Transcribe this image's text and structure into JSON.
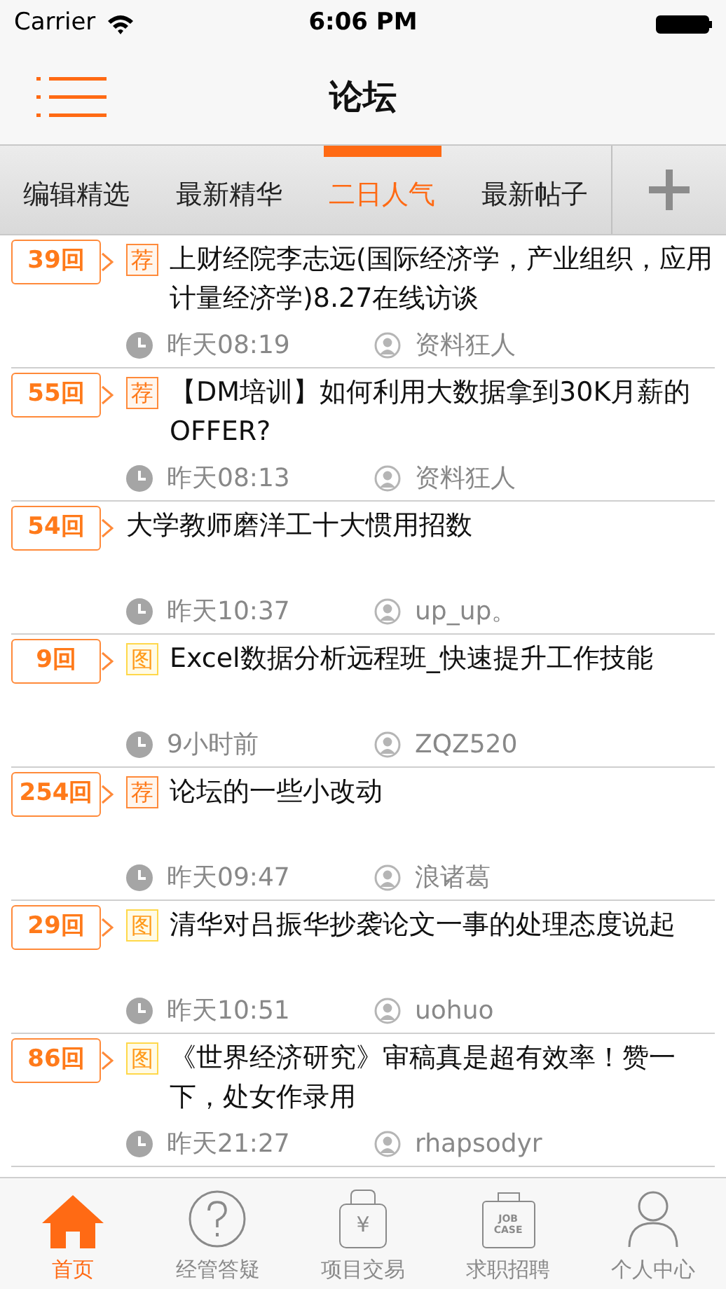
{
  "status_bar": {
    "carrier": "Carrier",
    "time": "6:06 PM"
  },
  "nav": {
    "title": "论坛"
  },
  "tabs": [
    {
      "label": "编辑精选",
      "selected": false
    },
    {
      "label": "最新精华",
      "selected": false
    },
    {
      "label": "二日人气",
      "selected": true
    },
    {
      "label": "最新帖子",
      "selected": false
    }
  ],
  "posts": [
    {
      "replies": "39回",
      "tag": {
        "text": "荐",
        "kind": "recommended"
      },
      "title": "上财经院李志远(国际经济学，产业组织，应用计量经济学)8.27在线访谈",
      "time": "昨天08:19",
      "author": "资料狂人"
    },
    {
      "replies": "55回",
      "tag": {
        "text": "荐",
        "kind": "recommended"
      },
      "title": "【DM培训】如何利用大数据拿到30K月薪的OFFER?",
      "time": "昨天08:13",
      "author": "资料狂人"
    },
    {
      "replies": "54回",
      "title": "大学教师磨洋工十大惯用招数",
      "time": "昨天10:37",
      "author": "up_up。"
    },
    {
      "replies": "9回",
      "tag": {
        "text": "图",
        "kind": "image"
      },
      "title": "Excel数据分析远程班_快速提升工作技能",
      "time": "9小时前",
      "author": "ZQZ520"
    },
    {
      "replies": "254回",
      "tag": {
        "text": "荐",
        "kind": "recommended"
      },
      "title": "论坛的一些小改动",
      "time": "昨天09:47",
      "author": "浪诸葛"
    },
    {
      "replies": "29回",
      "tag": {
        "text": "图",
        "kind": "image"
      },
      "title": "清华对吕振华抄袭论文一事的处理态度说起",
      "time": "昨天10:51",
      "author": "uohuo"
    },
    {
      "replies": "86回",
      "tag": {
        "text": "图",
        "kind": "image"
      },
      "title": "《世界经济研究》审稿真是超有效率！赞一下，处女作录用",
      "time": "昨天21:27",
      "author": "rhapsodyr"
    }
  ],
  "tab_bar": [
    {
      "label": "首页",
      "kind": "home",
      "selected": true
    },
    {
      "label": "经管答疑",
      "kind": "question",
      "selected": false
    },
    {
      "label": "项目交易",
      "kind": "money",
      "icon_text": [
        "¥"
      ],
      "selected": false
    },
    {
      "label": "求职招聘",
      "kind": "job",
      "icon_text": [
        "JOB",
        "CASE"
      ],
      "selected": false
    },
    {
      "label": "个人中心",
      "kind": "person",
      "selected": false
    }
  ]
}
